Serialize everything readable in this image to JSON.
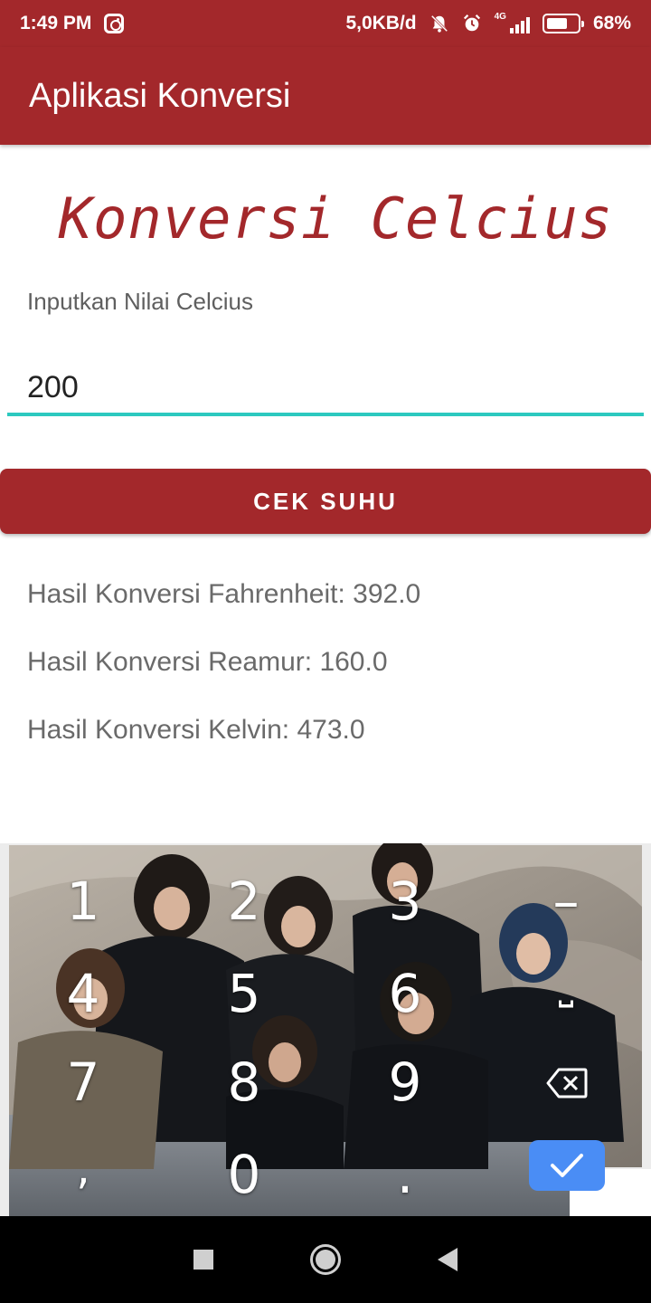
{
  "status_bar": {
    "time": "1:49 PM",
    "speed": "5,0KB/d",
    "network": "4G",
    "battery": "68%",
    "battery_level": 0.68
  },
  "app_bar": {
    "title": "Aplikasi Konversi"
  },
  "form": {
    "heading": "Konversi Celcius",
    "label": "Inputkan Nilai Celcius",
    "value": "200",
    "button_label": "CEK SUHU"
  },
  "results": {
    "fahrenheit": "Hasil Konversi Fahrenheit: 392.0",
    "reamur": "Hasil Konversi Reamur: 160.0",
    "kelvin": "Hasil Konversi Kelvin: 473.0"
  },
  "keyboard": {
    "keys": [
      "1",
      "2",
      "3",
      "–",
      "4",
      "5",
      "6",
      "⎵",
      "7",
      "8",
      "9",
      "0",
      ",",
      "."
    ],
    "enter_icon": "check-icon",
    "backspace_icon": "backspace-icon"
  },
  "colors": {
    "primary": "#a3282b",
    "accent": "#2cc9bf",
    "enter_key": "#4a8df5"
  },
  "nav": {
    "recent_icon": "square-icon",
    "home_icon": "circle-icon",
    "back_icon": "triangle-back-icon"
  }
}
